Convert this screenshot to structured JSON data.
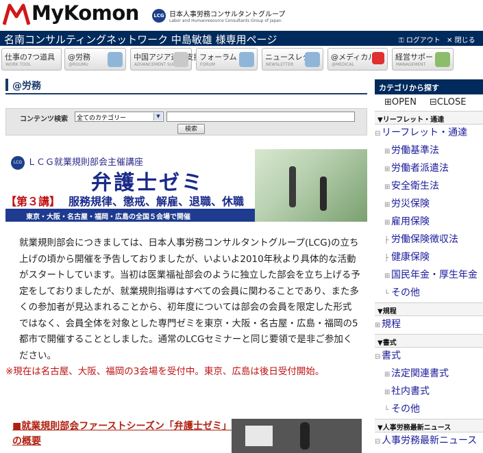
{
  "header": {
    "brand": "MyKomon",
    "lcg_mark": "LCG",
    "group_name": "日本人事労務コンサルタントグループ",
    "group_sub": "Labor and Humanresource Consultants Group of Japan"
  },
  "bluebar": {
    "title": "名南コンサルティングネットワーク 中島敏雄 様専用ページ",
    "logout": "ログアウト",
    "close": "閉じる"
  },
  "nav": [
    {
      "label": "仕事の7つ道具",
      "sub": "WORK TOOL"
    },
    {
      "label": "@労務",
      "sub": "@ROUMU"
    },
    {
      "label": "中国アジア進出支援",
      "sub": "ADVANCEMENT SUPPORT"
    },
    {
      "label": "フォーラム",
      "sub": "FORUM"
    },
    {
      "label": "ニュースレター",
      "sub": "NEWSLETTER"
    },
    {
      "label": "@メディカル",
      "sub": "@MEDICAL"
    },
    {
      "label": "経営サポート",
      "sub": "MANAGEMENT"
    }
  ],
  "page_title": "@労務",
  "search": {
    "label": "コンテンツ検索",
    "category": "全てのカテゴリー",
    "button": "検索"
  },
  "banner": {
    "logo": "LCG",
    "small": "ＬＣＧ就業規則部会主催講座",
    "big": "弁護士ゼミ",
    "lecture": "【第３講】",
    "topic": "服務規律、懲戒、解雇、退職、休職",
    "strip": "東京・大阪・名古屋・福岡・広島の全国５会場で開催"
  },
  "body": {
    "p1": "就業規則部会につきましては、日本人事労務コンサルタントグループ(LCG)の立ち上げの頃から開催を予告しておりましたが、いよいよ2010年秋より具体的な活動がスタートしています。当初は医業福祉部会のように独立した部会を立ち上げる予定をしておりましたが、就業規則指導はすべての会員に関わることであり、また多くの参加者が見込まれることから、初年度については部会の会員を限定した形式ではなく、会員全体を対象とした専門ゼミを東京・大阪・名古屋・広島・福岡の5都市で開催することとしました。通常のLCGセミナーと同じ要領で是非ご参加ください。",
    "notice": "※現在は名古屋、大阪、福岡の3会場を受付中。東京、広島は後日受付開始。",
    "section_link": "■就業規則部会ファーストシーズン「弁護士ゼミ」の概要"
  },
  "sidebar": {
    "header": "カテゴリから探す",
    "open": "OPEN",
    "close": "CLOSE",
    "cat_leaflet": "▼リーフレット・通達",
    "leaflet_root": "リーフレット・通達",
    "leaflet_items": [
      "労働基準法",
      "労働者派遣法",
      "安全衛生法",
      "労災保険",
      "雇用保険",
      "労働保険徴収法",
      "健康保険",
      "国民年金・厚生年金",
      "その他"
    ],
    "cat_rules": "▼規程",
    "rules_root": "規程",
    "cat_docs": "▼書式",
    "docs_root": "書式",
    "docs_items": [
      "法定関連書式",
      "社内書式",
      "その他"
    ],
    "cat_news": "▼人事労務最新ニュース",
    "news_root": "人事労務最新ニュース"
  },
  "colors": {
    "brand_navy": "#002a5c",
    "accent_red": "#c01010",
    "link_blue": "#1a1a9a"
  }
}
